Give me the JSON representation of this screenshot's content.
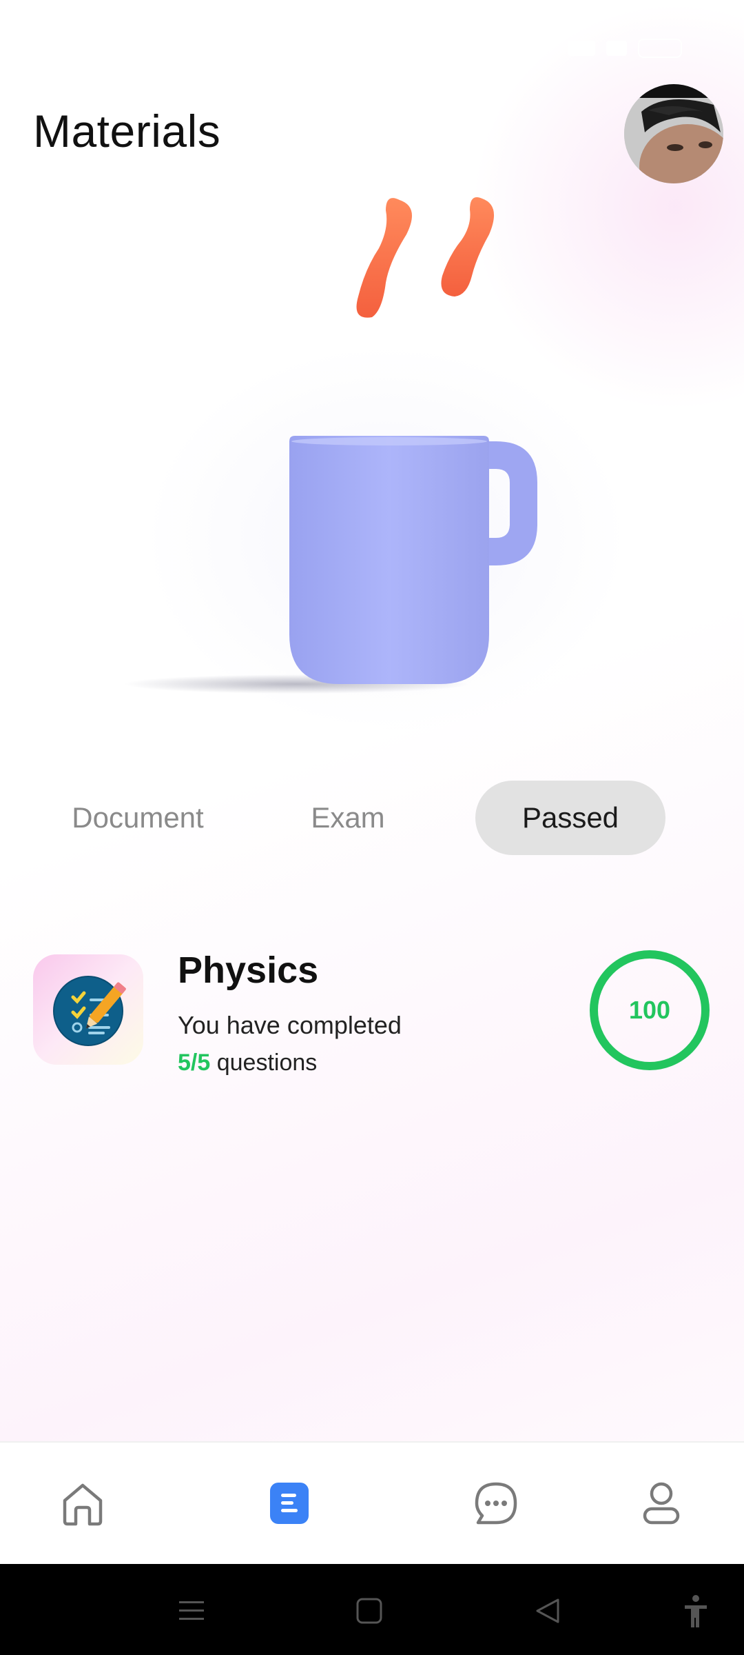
{
  "status_bar": {
    "time": "",
    "battery": ""
  },
  "header": {
    "title": "Materials"
  },
  "tabs": [
    {
      "label": "Document",
      "active": false
    },
    {
      "label": "Exam",
      "active": false
    },
    {
      "label": "Passed",
      "active": true
    }
  ],
  "course": {
    "title": "Physics",
    "subtitle": "You have completed",
    "progress": "5/5",
    "progress_suffix": " questions",
    "score": "100"
  },
  "bottom_nav": {
    "items": [
      {
        "icon": "home-icon",
        "active": false
      },
      {
        "icon": "document-icon",
        "active": true
      },
      {
        "icon": "chat-icon",
        "active": false
      },
      {
        "icon": "profile-icon",
        "active": false
      }
    ]
  },
  "colors": {
    "accent": "#3b82f6",
    "success": "#22c55e",
    "mug": "#a5aef5",
    "steam": "#fb6a4a",
    "active_tab_bg": "#e2e2e2"
  }
}
